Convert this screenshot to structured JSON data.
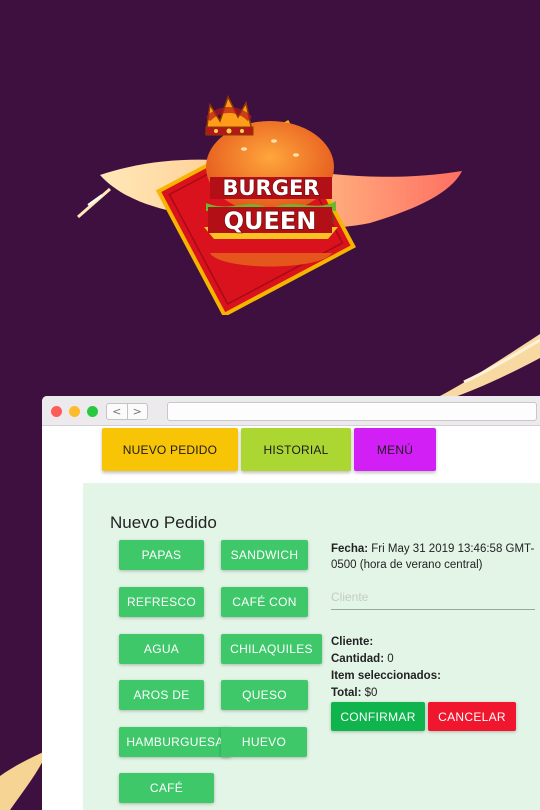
{
  "brand": {
    "line1": "BURGER",
    "line2": "QUEEN"
  },
  "browser": {
    "back_glyph": "<",
    "forward_glyph": ">"
  },
  "nav": {
    "tabs": [
      {
        "label": "NUEVO PEDIDO",
        "color": "#f8c406"
      },
      {
        "label": "HISTORIAL",
        "color": "#acd632"
      },
      {
        "label": "MENÚ",
        "color": "#d21ff5"
      }
    ]
  },
  "order": {
    "title": "Nuevo Pedido",
    "products": [
      "PAPAS",
      "SANDWICH",
      "REFRESCO",
      "CAFÉ CON",
      "AGUA",
      "CHILAQUILES",
      "AROS DE",
      "QUESO",
      "HAMBURGUESA",
      "HUEVO",
      "CAFÉ"
    ],
    "fecha_label": "Fecha:",
    "fecha_value": "Fri May 31 2019 13:46:58 GMT-0500 (hora de verano central)",
    "cliente_placeholder": "Cliente",
    "cliente_label": "Cliente:",
    "cliente_value": "",
    "cantidad_label": "Cantidad:",
    "cantidad_value": "0",
    "items_label": "Item seleccionados:",
    "items_value": "",
    "total_label": "Total:",
    "total_value": "$0",
    "confirm_label": "CONFIRMAR",
    "cancel_label": "CANCELAR"
  },
  "colors": {
    "background": "#3e1040",
    "panel": "#e3f5e7",
    "product_button": "#3ec86a",
    "confirm": "#0fb44d",
    "cancel": "#f0162e"
  }
}
